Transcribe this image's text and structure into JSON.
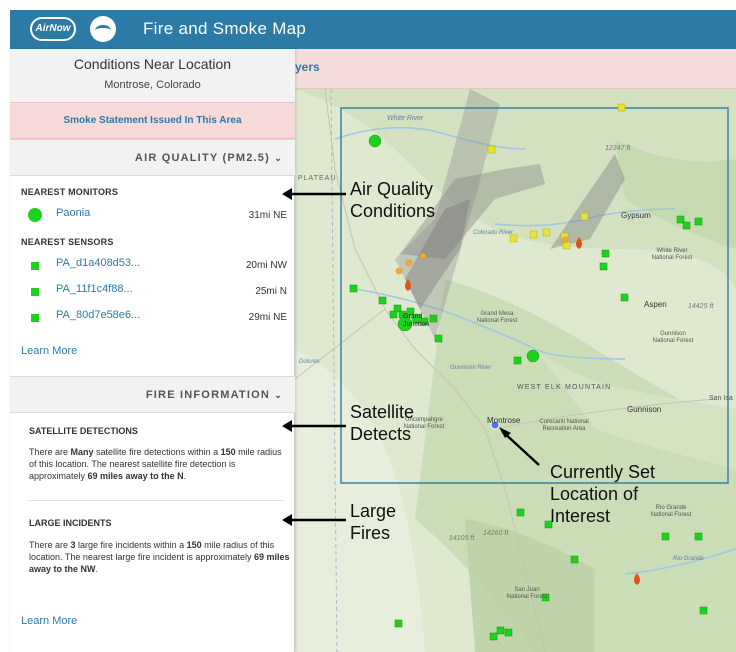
{
  "header": {
    "logo_text": "AirNow",
    "title": "Fire and Smoke Map",
    "brand_color": "#2b7ba6"
  },
  "layers_bar": {
    "text": "yers"
  },
  "conditions": {
    "title": "Conditions Near Location",
    "location": "Montrose, Colorado",
    "smoke_statement": "Smoke Statement Issued In This Area"
  },
  "air_quality": {
    "section_title": "AIR QUALITY (PM2.5)",
    "chevron_icon": "chevron-down-icon",
    "monitors_heading": "NEAREST MONITORS",
    "monitors": [
      {
        "name": "Paonia",
        "distance": "31mi NE",
        "color": "#1fd11f"
      }
    ],
    "sensors_heading": "NEAREST SENSORS",
    "sensors": [
      {
        "name": "PA_d1a408d53...",
        "distance": "20mi NW",
        "color": "#1fd11f"
      },
      {
        "name": "PA_11f1c4f88...",
        "distance": "25mi N",
        "color": "#1fd11f"
      },
      {
        "name": "PA_80d7e58e6...",
        "distance": "29mi NE",
        "color": "#1fd11f"
      }
    ],
    "learn_more": "Learn More"
  },
  "fire_info": {
    "section_title": "FIRE INFORMATION",
    "chevron_icon": "chevron-down-icon",
    "satellite": {
      "heading": "SATELLITE DETECTIONS",
      "text_1": "There are ",
      "bold_1": "Many",
      "text_2": " satellite fire detections within a ",
      "bold_2": "150",
      "text_3": " mile radius of this location. The nearest satellite fire detection is approximately ",
      "bold_3": "69 miles away to the N",
      "text_4": "."
    },
    "large": {
      "heading": "LARGE INCIDENTS",
      "text_1": "There are ",
      "bold_1": "3",
      "text_2": " large fire incidents within a ",
      "bold_2": "150",
      "text_3": " mile radius of this location. The nearest large fire incident is approximately ",
      "bold_3": "69 miles away to the NW",
      "text_4": "."
    },
    "learn_more": "Learn More"
  },
  "map": {
    "labels": {
      "white_river": "White River",
      "peak_12347": "12347 ft",
      "plateau": "PLATEAU",
      "gypsum": "Gypsum",
      "colorado_river": "Colorado River",
      "white_river_nf": "White River National Forest",
      "aspen": "Aspen",
      "peak_14425": "14425 ft",
      "grand_mesa": "Grand Mesa National Forest",
      "grand_junction": "Grand Junction",
      "gunnison_nf": "Gunnison National Forest",
      "gunnison_river": "Gunnison River",
      "west_elk": "WEST ELK MOUNTAIN",
      "gunnison": "Gunnison",
      "montrose": "Montrose",
      "uncompahgre": "Uncompahgre National Forest",
      "curecanti": "Curecanti National Recreation Area",
      "peak_14260": "14260 ft",
      "peak_14105": "14105 ft",
      "rio_grande_nf": "Rio Grande National Forest",
      "rio_grande": "Rio Grande",
      "san_juan": "San Juan National Forest",
      "dolores": "Dolores",
      "san_isabel": "San Isa"
    }
  },
  "annotations": {
    "air_quality": [
      "Air Quality",
      "Conditions"
    ],
    "satellite": [
      "Satellite",
      "Detects"
    ],
    "large_fires": [
      "Large",
      "Fires"
    ],
    "location": [
      "Currently Set",
      "Location of",
      "Interest"
    ]
  }
}
